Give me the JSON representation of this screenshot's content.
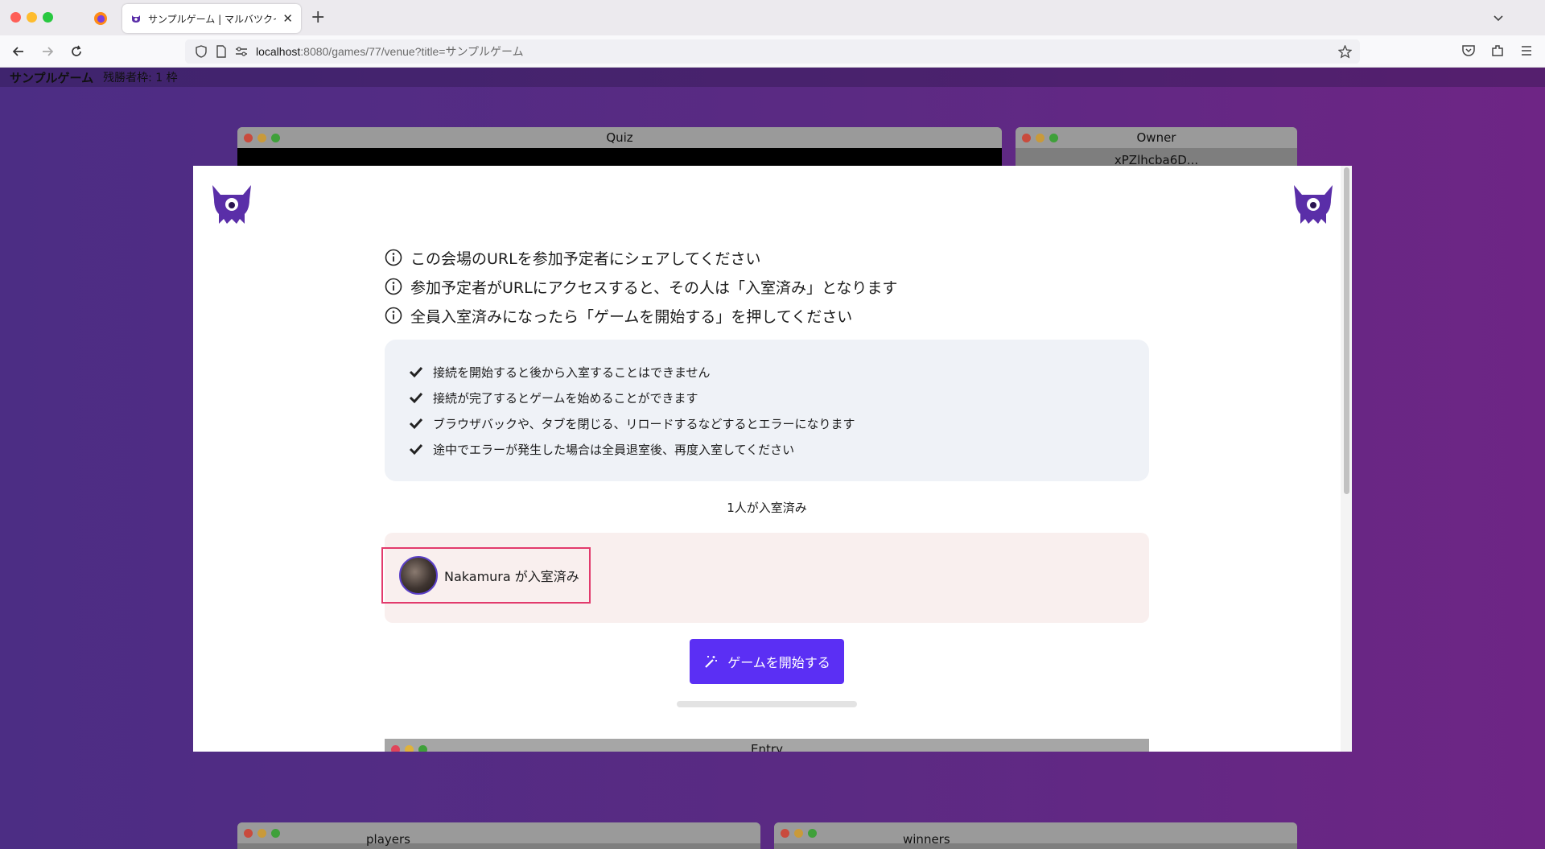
{
  "browser": {
    "tab_title": "サンプルゲーム | マルバツクイズ",
    "url_host": "localhost",
    "url_rest": ":8080/games/77/venue?title=サンプルゲーム"
  },
  "page_header": {
    "game_title": "サンプルゲーム",
    "remaining": "残勝者枠: 1 枠"
  },
  "background_windows": {
    "quiz": "Quiz",
    "owner": "Owner",
    "owner_id": "xPZlhcba6D...",
    "players": "players",
    "winners": "winners",
    "entry": "Entry"
  },
  "modal": {
    "info": [
      "この会場のURLを参加予定者にシェアしてください",
      "参加予定者がURLにアクセスすると、その人は「入室済み」となります",
      "全員入室済みになったら「ゲームを開始する」を押してください"
    ],
    "notices": [
      "接続を開始すると後から入室することはできません",
      "接続が完了するとゲームを始めることができます",
      "ブラウザバックや、タブを閉じる、リロードするなどするとエラーになります",
      "途中でエラーが発生した場合は全員退室後、再度入室してください"
    ],
    "entered_count": "1人が入室済み",
    "player": "Nakamura が入室済み",
    "start_button": "ゲームを開始する"
  },
  "colors": {
    "accent": "#5b2ff4",
    "highlight": "#e23a6c",
    "brand_purple": "#5a2ea8"
  }
}
